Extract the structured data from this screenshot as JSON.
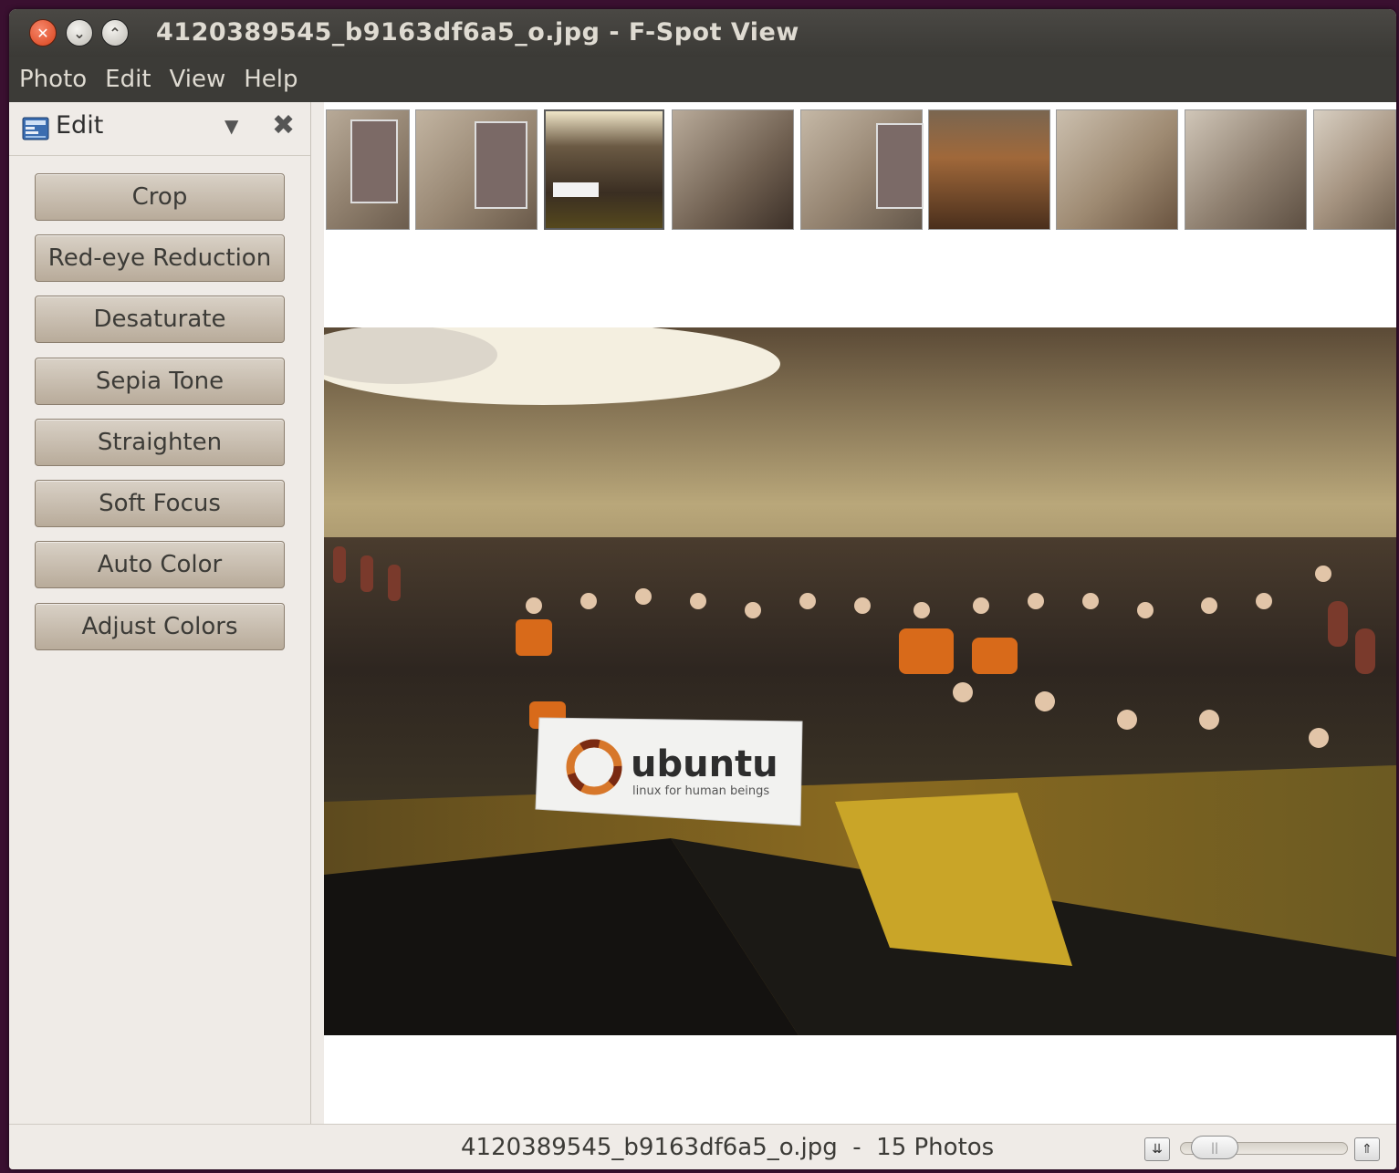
{
  "window": {
    "title": "4120389545_b9163df6a5_o.jpg - F-Spot View"
  },
  "menubar": {
    "items": [
      {
        "label": "Photo"
      },
      {
        "label": "Edit"
      },
      {
        "label": "View"
      },
      {
        "label": "Help"
      }
    ]
  },
  "sidebar": {
    "title": "Edit",
    "icon": "edit-panel-icon",
    "buttons": [
      {
        "label": "Crop"
      },
      {
        "label": "Red-eye Reduction"
      },
      {
        "label": "Desaturate"
      },
      {
        "label": "Sepia Tone"
      },
      {
        "label": "Straighten"
      },
      {
        "label": "Soft Focus"
      },
      {
        "label": "Auto Color"
      },
      {
        "label": "Adjust Colors"
      }
    ]
  },
  "filmstrip": {
    "thumbnails": [
      {
        "name": "easel-painting-thumbnail",
        "color": "#8a7c6c"
      },
      {
        "name": "easel-painting-2-thumbnail",
        "color": "#857867"
      },
      {
        "name": "group-photo-thumbnail",
        "color": "#5a4a3a"
      },
      {
        "name": "busts-shelf-thumbnail",
        "color": "#6a5a4d"
      },
      {
        "name": "easel-chair-thumbnail",
        "color": "#8d7f6f"
      },
      {
        "name": "pottery-table-thumbnail",
        "color": "#6b4b2e"
      },
      {
        "name": "room-corner-thumbnail",
        "color": "#8a7560"
      },
      {
        "name": "shelf-artifacts-thumbnail",
        "color": "#7d6f62"
      },
      {
        "name": "display-case-thumbnail",
        "color": "#9a8a78"
      }
    ],
    "selected_index": 2
  },
  "viewer": {
    "banner_text": "ubuntu",
    "banner_subtext": "linux for human beings"
  },
  "statusbar": {
    "text": "4120389545_b9163df6a5_o.jpg  -  15 Photos",
    "zoom_level": 0.1
  },
  "colors": {
    "titlebar": "#3c3b37",
    "button_bg": "#c9bfb2",
    "window_bg": "#efebe7"
  }
}
